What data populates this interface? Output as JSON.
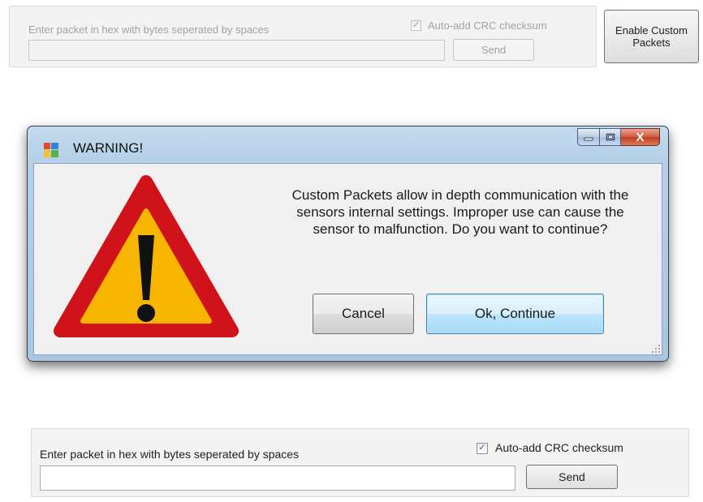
{
  "top_panel": {
    "prompt": "Enter packet in hex with bytes seperated by spaces",
    "packet_value": "",
    "crc_label": "Auto-add CRC checksum",
    "crc_checked": true,
    "send_label": "Send",
    "state": "disabled"
  },
  "enable_button": {
    "line1": "Enable Custom",
    "line2": "Packets"
  },
  "dialog": {
    "title": "WARNING!",
    "message_lines": [
      "Custom Packets allow in depth communication with the",
      "sensors internal settings. Improper use can cause the",
      "sensor to malfunction. Do you want to continue?"
    ],
    "cancel_label": "Cancel",
    "ok_label": "Ok, Continue",
    "close_glyph": "X",
    "colors": {
      "warning_red": "#d0121b",
      "warning_yellow": "#f7b500",
      "title_bar": "#b5d0e8",
      "close_red": "#c23b1f"
    }
  },
  "bottom_panel": {
    "prompt": "Enter packet in hex with bytes seperated by spaces",
    "packet_value": "",
    "crc_label": "Auto-add CRC checksum",
    "crc_checked": true,
    "send_label": "Send",
    "state": "enabled"
  }
}
